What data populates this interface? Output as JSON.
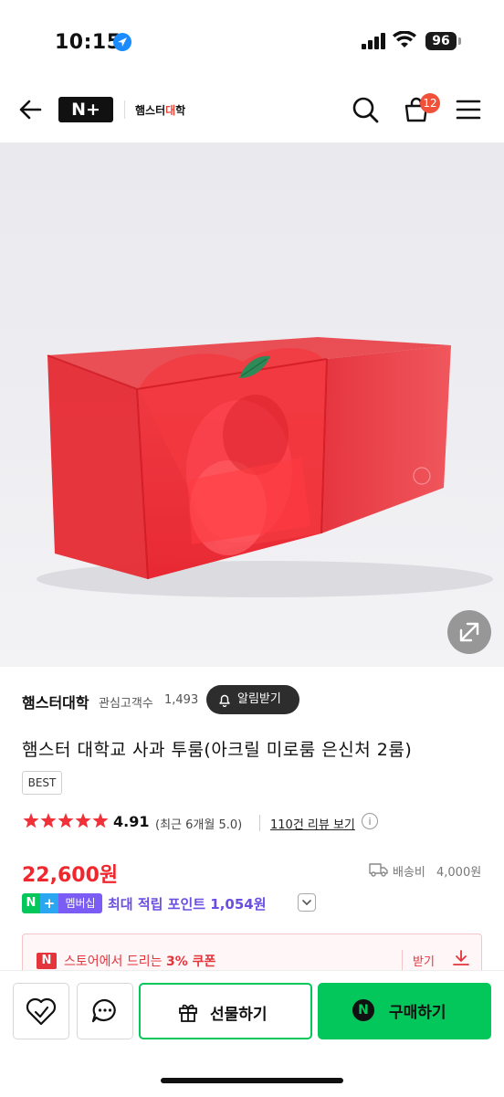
{
  "status_bar": {
    "time": "10:15",
    "battery": "96"
  },
  "header": {
    "brand_label": "N+",
    "store_logo_a": "햄스터",
    "store_logo_b": "대",
    "store_logo_c": "학",
    "cart_count": "12"
  },
  "store": {
    "name": "햄스터대학",
    "follower_label": "관심고객수",
    "follower_count": "1,493",
    "alert_label": "알림받기"
  },
  "product": {
    "title": "햄스터 대학교 사과 투룸(아크릴 미로룸 은신처 2룸)",
    "badge": "BEST",
    "rating_stars": 5,
    "rating": "4.91",
    "rating_recent": "(최근 6개월 5.0)",
    "review_link": "110건 리뷰 보기",
    "price": "22,600원",
    "shipping_label": "배송비",
    "shipping_value": "4,000원"
  },
  "membership": {
    "badge_n": "N",
    "badge_plus": "+",
    "badge_text": "멤버십",
    "point_text": "최대 적립 포인트 1,054원"
  },
  "coupon": {
    "n_label": "N",
    "text_prefix": "스토어에서 드리는 ",
    "text_bold": "3% 쿠폰",
    "get_label": "받기"
  },
  "bottom": {
    "gift_label": "선물하기",
    "buy_n": "N",
    "buy_label": "구매하기"
  },
  "colors": {
    "price_red": "#f0282d",
    "naver_green": "#03c75a",
    "membership_purple": "#7b5cf5",
    "coupon_red": "#e4343c"
  }
}
